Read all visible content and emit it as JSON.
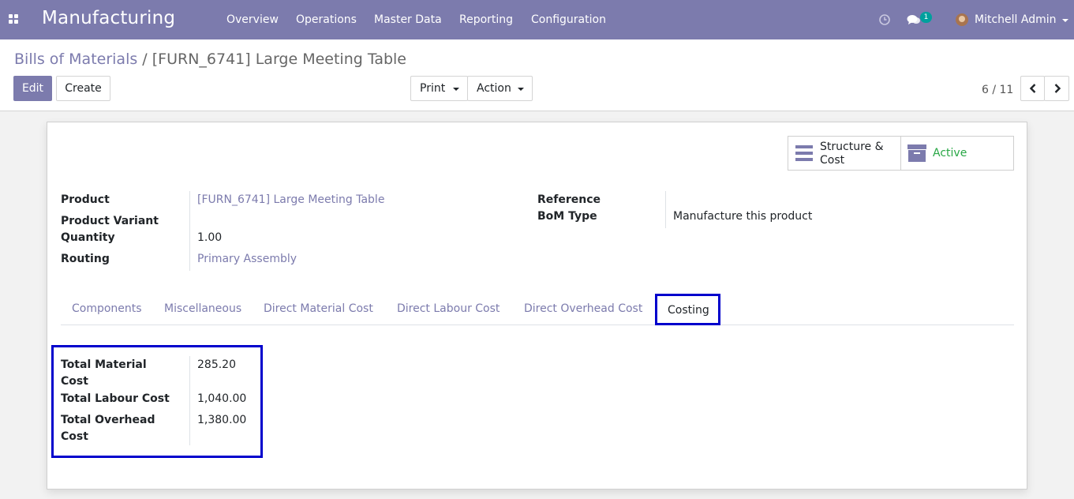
{
  "app": {
    "title": "Manufacturing"
  },
  "nav": {
    "menu": [
      "Overview",
      "Operations",
      "Master Data",
      "Reporting",
      "Configuration"
    ],
    "messages_count": "1",
    "user_name": "Mitchell Admin"
  },
  "breadcrumb": {
    "parent": "Bills of Materials",
    "separator": "/",
    "current": "[FURN_6741] Large Meeting Table"
  },
  "toolbar": {
    "edit_label": "Edit",
    "create_label": "Create",
    "print_label": "Print",
    "action_label": "Action"
  },
  "pager": {
    "value": "6 / 11"
  },
  "smart_buttons": {
    "structure_cost_line1": "Structure &",
    "structure_cost_line2": "Cost",
    "active_label": "Active"
  },
  "fields": {
    "product": {
      "label": "Product",
      "value": "[FURN_6741] Large Meeting Table"
    },
    "product_variant": {
      "label": "Product Variant",
      "value": ""
    },
    "quantity": {
      "label": "Quantity",
      "value": "1.00"
    },
    "routing": {
      "label": "Routing",
      "value": "Primary Assembly"
    },
    "reference": {
      "label": "Reference",
      "value": ""
    },
    "bom_type": {
      "label": "BoM Type",
      "value": "Manufacture this product"
    }
  },
  "tabs": [
    "Components",
    "Miscellaneous",
    "Direct Material Cost",
    "Direct Labour Cost",
    "Direct Overhead Cost",
    "Costing"
  ],
  "active_tab": "Costing",
  "costing": {
    "material": {
      "label_line1": "Total Material",
      "label_line2": "Cost",
      "value": "285.20"
    },
    "labour": {
      "label": "Total Labour Cost",
      "value": "1,040.00"
    },
    "overhead": {
      "label_line1": "Total Overhead",
      "label_line2": "Cost",
      "value": "1,380.00"
    }
  },
  "colors": {
    "brand": "#7c7bad",
    "highlight": "#0000cc",
    "active_status": "#28a745",
    "badge": "#00a09d"
  }
}
